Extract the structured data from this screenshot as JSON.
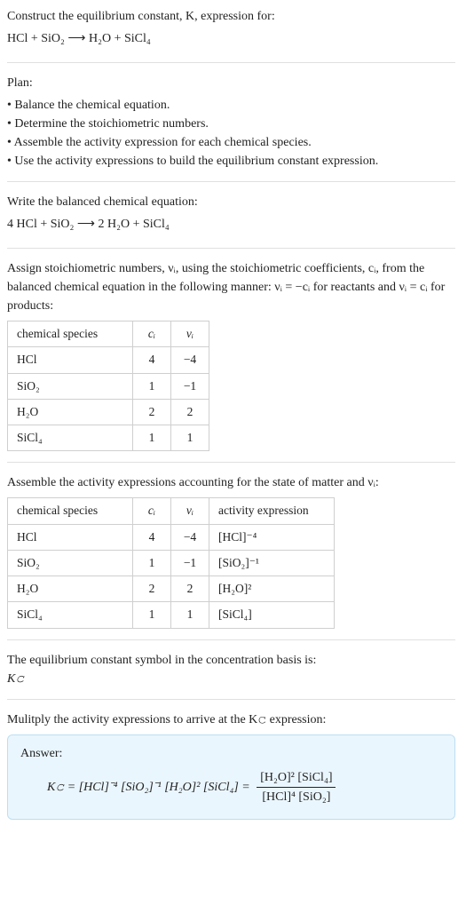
{
  "prompt": {
    "line1": "Construct the equilibrium constant, K, expression for:",
    "equation": "HCl + SiO₂  ⟶  H₂O + SiCl₄"
  },
  "plan": {
    "heading": "Plan:",
    "items": [
      "Balance the chemical equation.",
      "Determine the stoichiometric numbers.",
      "Assemble the activity expression for each chemical species.",
      "Use the activity expressions to build the equilibrium constant expression."
    ]
  },
  "balanced": {
    "heading": "Write the balanced chemical equation:",
    "equation": "4 HCl + SiO₂  ⟶  2 H₂O + SiCl₄"
  },
  "stoich": {
    "heading": "Assign stoichiometric numbers, νᵢ, using the stoichiometric coefficients, cᵢ, from the balanced chemical equation in the following manner: νᵢ = −cᵢ for reactants and νᵢ = cᵢ for products:",
    "cols": {
      "species": "chemical species",
      "c": "cᵢ",
      "v": "νᵢ"
    },
    "rows": [
      {
        "species": "HCl",
        "c": "4",
        "v": "−4"
      },
      {
        "species": "SiO₂",
        "c": "1",
        "v": "−1"
      },
      {
        "species": "H₂O",
        "c": "2",
        "v": "2"
      },
      {
        "species": "SiCl₄",
        "c": "1",
        "v": "1"
      }
    ]
  },
  "activity": {
    "heading": "Assemble the activity expressions accounting for the state of matter and νᵢ:",
    "cols": {
      "species": "chemical species",
      "c": "cᵢ",
      "v": "νᵢ",
      "act": "activity expression"
    },
    "rows": [
      {
        "species": "HCl",
        "c": "4",
        "v": "−4",
        "act": "[HCl]⁻⁴"
      },
      {
        "species": "SiO₂",
        "c": "1",
        "v": "−1",
        "act": "[SiO₂]⁻¹"
      },
      {
        "species": "H₂O",
        "c": "2",
        "v": "2",
        "act": "[H₂O]²"
      },
      {
        "species": "SiCl₄",
        "c": "1",
        "v": "1",
        "act": "[SiCl₄]"
      }
    ]
  },
  "kc_symbol": {
    "line1": "The equilibrium constant symbol in the concentration basis is:",
    "line2": "K𝚌"
  },
  "final": {
    "heading": "Mulitply the activity expressions to arrive at the K𝚌 expression:",
    "answer_label": "Answer:",
    "lhs": "K𝚌 = [HCl]⁻⁴ [SiO₂]⁻¹ [H₂O]² [SiCl₄] = ",
    "numerator": "[H₂O]² [SiCl₄]",
    "denominator": "[HCl]⁴ [SiO₂]"
  },
  "chart_data": {
    "type": "table",
    "tables": [
      {
        "name": "stoichiometric_numbers",
        "columns": [
          "chemical species",
          "cᵢ",
          "νᵢ"
        ],
        "rows": [
          [
            "HCl",
            4,
            -4
          ],
          [
            "SiO₂",
            1,
            -1
          ],
          [
            "H₂O",
            2,
            2
          ],
          [
            "SiCl₄",
            1,
            1
          ]
        ]
      },
      {
        "name": "activity_expressions",
        "columns": [
          "chemical species",
          "cᵢ",
          "νᵢ",
          "activity expression"
        ],
        "rows": [
          [
            "HCl",
            4,
            -4,
            "[HCl]^-4"
          ],
          [
            "SiO₂",
            1,
            -1,
            "[SiO2]^-1"
          ],
          [
            "H₂O",
            2,
            2,
            "[H2O]^2"
          ],
          [
            "SiCl₄",
            1,
            1,
            "[SiCl4]"
          ]
        ]
      }
    ]
  }
}
